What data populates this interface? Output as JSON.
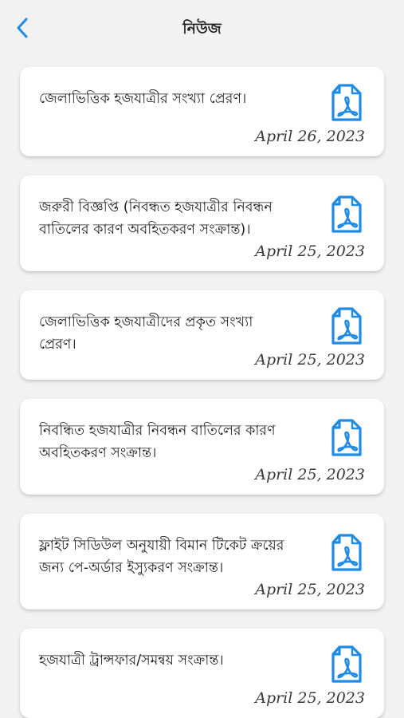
{
  "header": {
    "title": "নিউজ",
    "back_icon": "chevron-left-icon"
  },
  "colors": {
    "accent": "#1f8be6",
    "background": "#f2f2f3",
    "card": "#ffffff"
  },
  "news": [
    {
      "title": "জেলাভিত্তিক হজযাত্রীর সংখ্যা প্রেরণ।",
      "date": "April 26, 2023",
      "icon": "pdf-file-icon"
    },
    {
      "title": "জরুরী বিজ্ঞপ্তি (নিবন্ধত হজযাত্রীর নিবন্ধন বাতিলের কারণ অবহিতকরণ সংক্রান্ত)।",
      "date": "April 25, 2023",
      "icon": "pdf-file-icon"
    },
    {
      "title": "জেলাভিত্তিক হজযাত্রীদের প্রকৃত সংখ্যা প্রেরণ।",
      "date": "April 25, 2023",
      "icon": "pdf-file-icon"
    },
    {
      "title": "নিবন্ধিত হজযাত্রীর নিবন্ধন বাতিলের কারণ অবহিতকরণ সংক্রান্ত।",
      "date": "April 25, 2023",
      "icon": "pdf-file-icon"
    },
    {
      "title": "ফ্লাইট সিডিউল অনুযায়ী বিমান টিকেট ক্রয়ের জন্য পে-অর্ডার ইস্যুকরণ সংক্রান্ত।",
      "date": "April 25, 2023",
      "icon": "pdf-file-icon"
    },
    {
      "title": "হজযাত্রী ট্রান্সফার/সমন্বয় সংক্রান্ত।",
      "date": "April 25, 2023",
      "icon": "pdf-file-icon"
    }
  ]
}
